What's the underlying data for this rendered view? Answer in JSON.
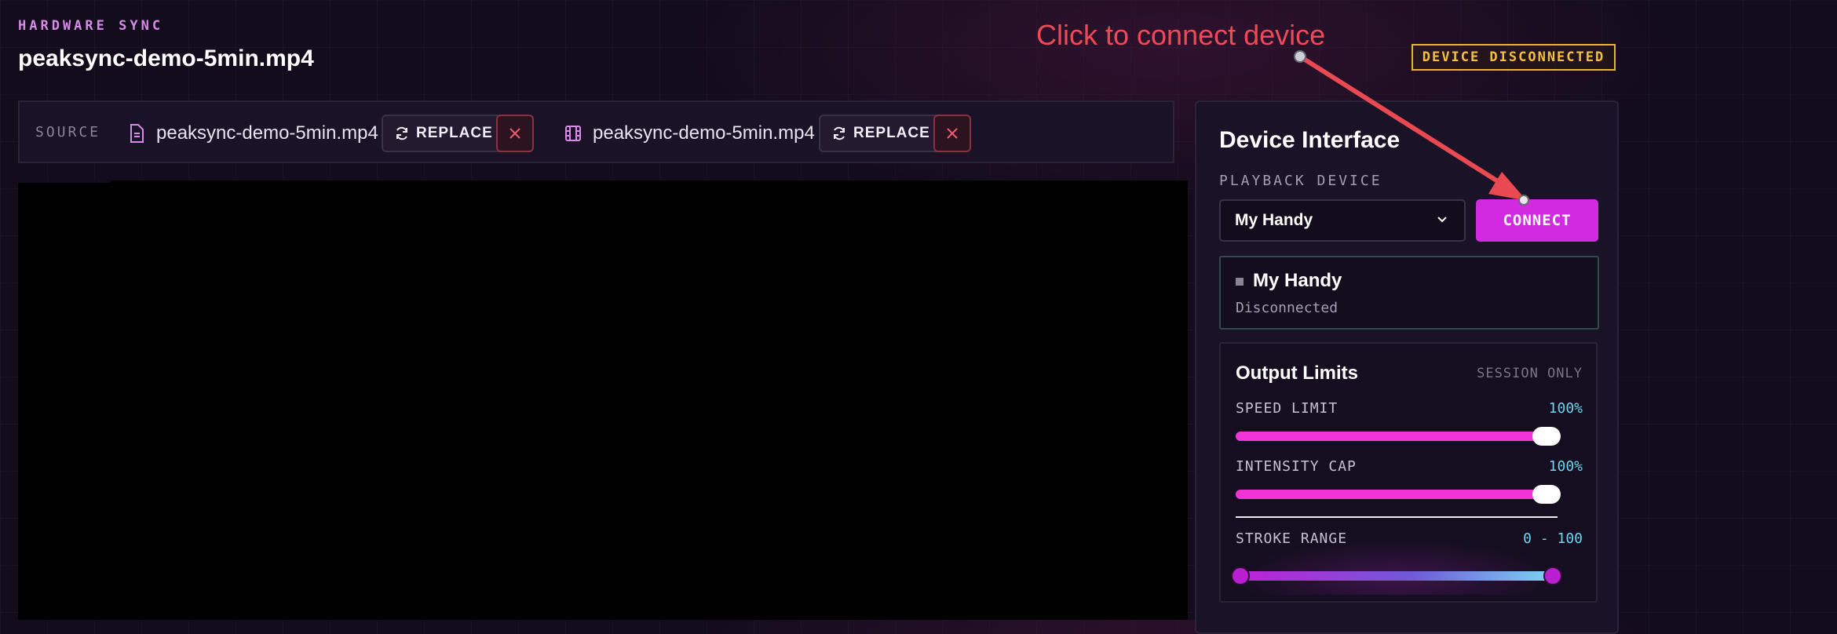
{
  "header": {
    "eyebrow": "HARDWARE SYNC",
    "file_title": "peaksync-demo-5min.mp4",
    "status_badge": "DEVICE DISCONNECTED"
  },
  "annotation": {
    "text": "Click to connect device"
  },
  "source_bar": {
    "label": "SOURCE",
    "files": [
      {
        "icon": "document-icon",
        "name": "peaksync-demo-5min.mp4",
        "replace_label": "REPLACE",
        "remove_icon": "close-icon"
      },
      {
        "icon": "film-icon",
        "name": "peaksync-demo-5min.mp4",
        "replace_label": "REPLACE",
        "remove_icon": "close-icon"
      }
    ]
  },
  "device_panel": {
    "title": "Device Interface",
    "playback_label": "PLAYBACK DEVICE",
    "selected_device": "My Handy",
    "connect_label": "CONNECT",
    "device_card": {
      "name": "My Handy",
      "status": "Disconnected"
    }
  },
  "output_limits": {
    "title": "Output Limits",
    "session_label": "SESSION ONLY",
    "speed": {
      "label": "SPEED LIMIT",
      "value": "100%",
      "fraction": 1.0
    },
    "intensity": {
      "label": "INTENSITY CAP",
      "value": "100%",
      "fraction": 1.0
    },
    "stroke": {
      "label": "STROKE RANGE",
      "value": "0 - 100",
      "min": 0,
      "max": 100
    }
  },
  "colors": {
    "accent": "#d22ae0",
    "warning": "#f4c13e",
    "annotation": "#ee4a55",
    "value_cyan": "#6ed4f0"
  }
}
